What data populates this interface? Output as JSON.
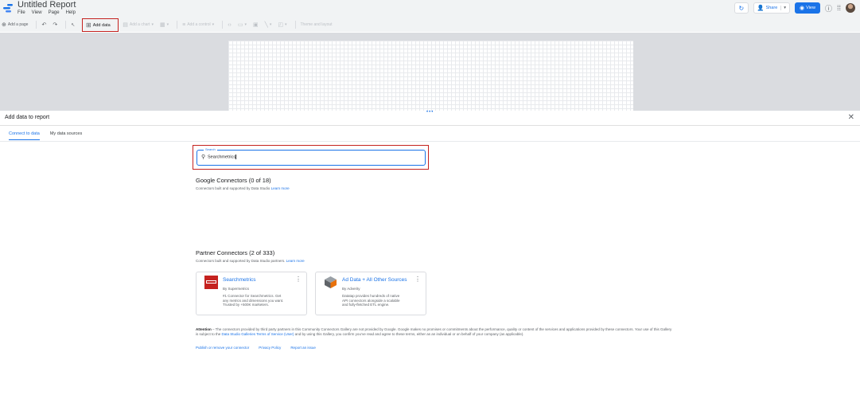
{
  "app": {
    "title": "Untitled Report"
  },
  "menu": [
    "File",
    "View",
    "Page",
    "Help"
  ],
  "toolbar": {
    "add_page": "Add a page",
    "add_data": "Add data",
    "add_chart": "Add a chart",
    "add_control": "Add a control",
    "theme": "Theme and layout"
  },
  "header_right": {
    "share": "Share",
    "view": "View"
  },
  "panel": {
    "title": "Add data to report",
    "tabs": [
      {
        "label": "Connect to data",
        "active": true
      },
      {
        "label": "My data sources",
        "active": false
      }
    ],
    "search": {
      "label": "Search",
      "value": "Searchmetrics"
    },
    "google": {
      "heading": "Google Connectors (0 of 18)",
      "sub": "Connectors built and supported by Data Studio",
      "learn": "Learn more"
    },
    "partner": {
      "heading": "Partner Connectors (2 of 333)",
      "sub": "Connectors built and supported by Data Studio partners.",
      "learn": "Learn more"
    },
    "cards": [
      {
        "name": "Searchmetrics",
        "by": "By Supermetrics",
        "desc": "#1 Connector for Searchmetrics. Get any metrics and dimensions you want. Trusted by +500K marketers."
      },
      {
        "name": "Ad Data + All Other Sources",
        "by": "By Adverity",
        "desc": "Datatap provides hundreds of native API connectors alongside a scalable and fully-fletched ETL engine."
      }
    ],
    "attention": {
      "bold": "Attention",
      "text": " – The connectors provided by third party partners in this Community Connectors Gallery are not provided by Google. Google makes no promises or commitments about the performance, quality or content of the services and applications provided by these connectors. Your use of this Gallery is subject to the ",
      "link": "Data Studio Galleries Terms of Service (User)",
      "text2": " and by using this Gallery, you confirm you’ve read and agree to these terms, either as an individual or on behalf of your company (as applicable)."
    },
    "links": [
      "Publish or remove your connector",
      "Privacy Policy",
      "Report an issue"
    ]
  }
}
